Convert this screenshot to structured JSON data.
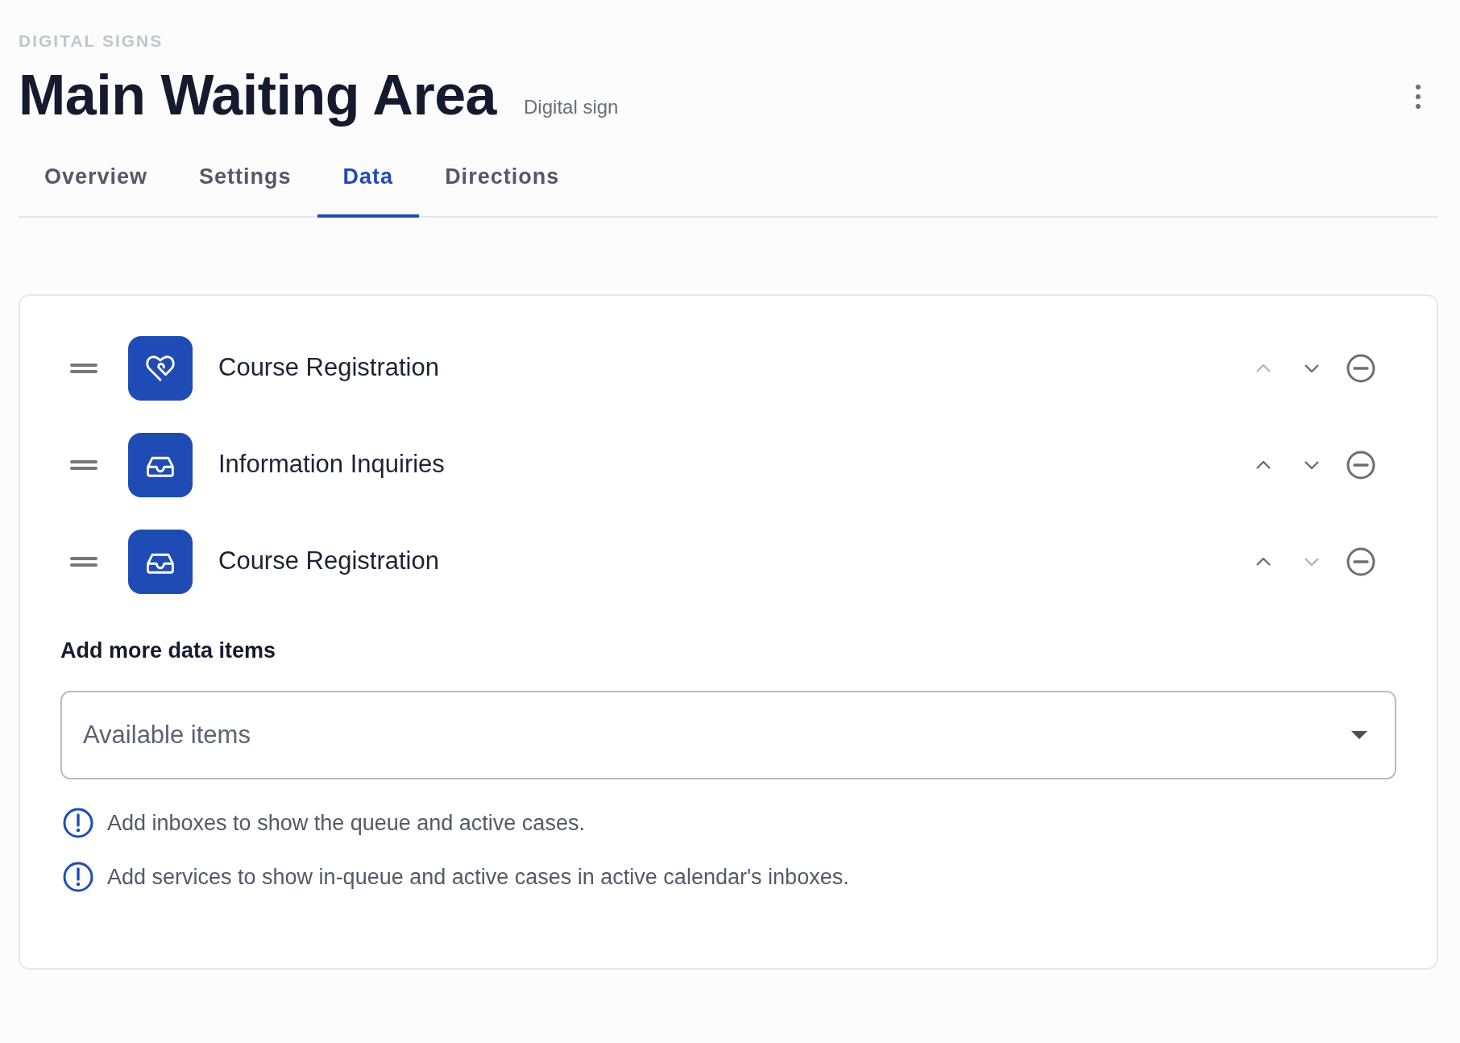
{
  "breadcrumb": "DIGITAL SIGNS",
  "title": "Main Waiting Area",
  "subtitle": "Digital sign",
  "tabs": [
    {
      "label": "Overview",
      "selected": false
    },
    {
      "label": "Settings",
      "selected": false
    },
    {
      "label": "Data",
      "selected": true
    },
    {
      "label": "Directions",
      "selected": false
    }
  ],
  "data_items": [
    {
      "label": "Course Registration",
      "kind": "heart",
      "up_disabled": true,
      "down_disabled": false
    },
    {
      "label": "Information Inquiries",
      "kind": "inbox",
      "up_disabled": false,
      "down_disabled": false
    },
    {
      "label": "Course Registration",
      "kind": "inbox",
      "up_disabled": false,
      "down_disabled": true
    }
  ],
  "add_section": {
    "heading": "Add more data items",
    "select": {
      "placeholder": "Available items"
    }
  },
  "notes": [
    "Add inboxes to show the queue and active cases.",
    "Add services to show in-queue and active cases in active calendar's inboxes."
  ]
}
